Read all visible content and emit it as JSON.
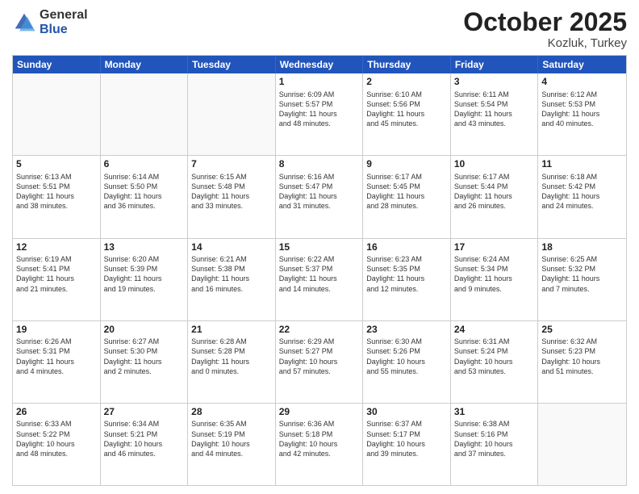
{
  "header": {
    "logo_general": "General",
    "logo_blue": "Blue",
    "month_title": "October 2025",
    "location": "Kozluk, Turkey"
  },
  "weekdays": [
    "Sunday",
    "Monday",
    "Tuesday",
    "Wednesday",
    "Thursday",
    "Friday",
    "Saturday"
  ],
  "weeks": [
    [
      {
        "day": "",
        "info": ""
      },
      {
        "day": "",
        "info": ""
      },
      {
        "day": "",
        "info": ""
      },
      {
        "day": "1",
        "info": "Sunrise: 6:09 AM\nSunset: 5:57 PM\nDaylight: 11 hours\nand 48 minutes."
      },
      {
        "day": "2",
        "info": "Sunrise: 6:10 AM\nSunset: 5:56 PM\nDaylight: 11 hours\nand 45 minutes."
      },
      {
        "day": "3",
        "info": "Sunrise: 6:11 AM\nSunset: 5:54 PM\nDaylight: 11 hours\nand 43 minutes."
      },
      {
        "day": "4",
        "info": "Sunrise: 6:12 AM\nSunset: 5:53 PM\nDaylight: 11 hours\nand 40 minutes."
      }
    ],
    [
      {
        "day": "5",
        "info": "Sunrise: 6:13 AM\nSunset: 5:51 PM\nDaylight: 11 hours\nand 38 minutes."
      },
      {
        "day": "6",
        "info": "Sunrise: 6:14 AM\nSunset: 5:50 PM\nDaylight: 11 hours\nand 36 minutes."
      },
      {
        "day": "7",
        "info": "Sunrise: 6:15 AM\nSunset: 5:48 PM\nDaylight: 11 hours\nand 33 minutes."
      },
      {
        "day": "8",
        "info": "Sunrise: 6:16 AM\nSunset: 5:47 PM\nDaylight: 11 hours\nand 31 minutes."
      },
      {
        "day": "9",
        "info": "Sunrise: 6:17 AM\nSunset: 5:45 PM\nDaylight: 11 hours\nand 28 minutes."
      },
      {
        "day": "10",
        "info": "Sunrise: 6:17 AM\nSunset: 5:44 PM\nDaylight: 11 hours\nand 26 minutes."
      },
      {
        "day": "11",
        "info": "Sunrise: 6:18 AM\nSunset: 5:42 PM\nDaylight: 11 hours\nand 24 minutes."
      }
    ],
    [
      {
        "day": "12",
        "info": "Sunrise: 6:19 AM\nSunset: 5:41 PM\nDaylight: 11 hours\nand 21 minutes."
      },
      {
        "day": "13",
        "info": "Sunrise: 6:20 AM\nSunset: 5:39 PM\nDaylight: 11 hours\nand 19 minutes."
      },
      {
        "day": "14",
        "info": "Sunrise: 6:21 AM\nSunset: 5:38 PM\nDaylight: 11 hours\nand 16 minutes."
      },
      {
        "day": "15",
        "info": "Sunrise: 6:22 AM\nSunset: 5:37 PM\nDaylight: 11 hours\nand 14 minutes."
      },
      {
        "day": "16",
        "info": "Sunrise: 6:23 AM\nSunset: 5:35 PM\nDaylight: 11 hours\nand 12 minutes."
      },
      {
        "day": "17",
        "info": "Sunrise: 6:24 AM\nSunset: 5:34 PM\nDaylight: 11 hours\nand 9 minutes."
      },
      {
        "day": "18",
        "info": "Sunrise: 6:25 AM\nSunset: 5:32 PM\nDaylight: 11 hours\nand 7 minutes."
      }
    ],
    [
      {
        "day": "19",
        "info": "Sunrise: 6:26 AM\nSunset: 5:31 PM\nDaylight: 11 hours\nand 4 minutes."
      },
      {
        "day": "20",
        "info": "Sunrise: 6:27 AM\nSunset: 5:30 PM\nDaylight: 11 hours\nand 2 minutes."
      },
      {
        "day": "21",
        "info": "Sunrise: 6:28 AM\nSunset: 5:28 PM\nDaylight: 11 hours\nand 0 minutes."
      },
      {
        "day": "22",
        "info": "Sunrise: 6:29 AM\nSunset: 5:27 PM\nDaylight: 10 hours\nand 57 minutes."
      },
      {
        "day": "23",
        "info": "Sunrise: 6:30 AM\nSunset: 5:26 PM\nDaylight: 10 hours\nand 55 minutes."
      },
      {
        "day": "24",
        "info": "Sunrise: 6:31 AM\nSunset: 5:24 PM\nDaylight: 10 hours\nand 53 minutes."
      },
      {
        "day": "25",
        "info": "Sunrise: 6:32 AM\nSunset: 5:23 PM\nDaylight: 10 hours\nand 51 minutes."
      }
    ],
    [
      {
        "day": "26",
        "info": "Sunrise: 6:33 AM\nSunset: 5:22 PM\nDaylight: 10 hours\nand 48 minutes."
      },
      {
        "day": "27",
        "info": "Sunrise: 6:34 AM\nSunset: 5:21 PM\nDaylight: 10 hours\nand 46 minutes."
      },
      {
        "day": "28",
        "info": "Sunrise: 6:35 AM\nSunset: 5:19 PM\nDaylight: 10 hours\nand 44 minutes."
      },
      {
        "day": "29",
        "info": "Sunrise: 6:36 AM\nSunset: 5:18 PM\nDaylight: 10 hours\nand 42 minutes."
      },
      {
        "day": "30",
        "info": "Sunrise: 6:37 AM\nSunset: 5:17 PM\nDaylight: 10 hours\nand 39 minutes."
      },
      {
        "day": "31",
        "info": "Sunrise: 6:38 AM\nSunset: 5:16 PM\nDaylight: 10 hours\nand 37 minutes."
      },
      {
        "day": "",
        "info": ""
      }
    ]
  ]
}
